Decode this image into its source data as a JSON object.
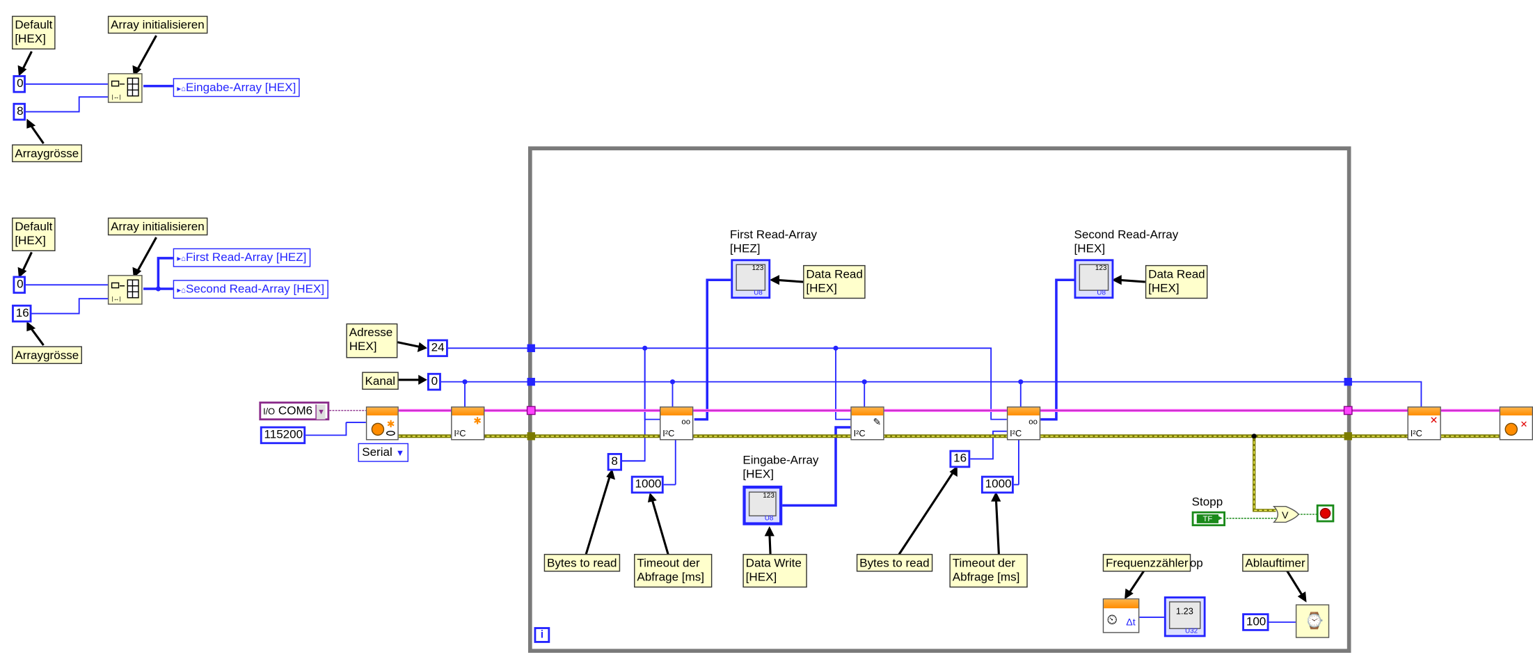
{
  "colors": {
    "wire_blue": "#2424ff",
    "wire_pink": "#ff66ff",
    "wire_error": "#7a7a00",
    "loop_frame": "#7a7a7a",
    "note_bg": "#ffffcc",
    "node_orange": "#ff8c00",
    "bool_green": "#1a8a1a",
    "stop_red": "#e00000"
  },
  "top_block": {
    "default_note": "Default\n[HEX]",
    "array_init_note": "Array initialisieren",
    "const_default": "0",
    "const_size": "8",
    "size_note": "Arraygrösse",
    "indicator": "Eingabe-Array [HEX]"
  },
  "mid_block": {
    "default_note": "Default\n[HEX]",
    "array_init_note": "Array initialisieren",
    "const_default": "0",
    "const_size": "16",
    "size_note": "Arraygrösse",
    "indicator_first": "First Read-Array [HEZ]",
    "indicator_second": "Second Read-Array [HEX]"
  },
  "inputs": {
    "adresse_note": "Adresse\nHEX]",
    "adresse_value": "24",
    "kanal_note": "Kanal",
    "kanal_value": "0",
    "com_port": "COM6",
    "baud": "115200",
    "interface": "Serial"
  },
  "loop": {
    "first_read_label": "First Read-Array\n[HEZ]",
    "first_data_read_note": "Data Read\n[HEX]",
    "second_read_label": "Second Read-Array\n[HEX]",
    "second_data_read_note": "Data Read\n[HEX]",
    "eingabe_label": "Eingabe-Array\n[HEX]",
    "data_write_note": "Data Write\n[HEX]",
    "bytes1_value": "8",
    "timeout1_value": "1000",
    "bytes2_value": "16",
    "timeout2_value": "1000",
    "bytes_note_1": "Bytes to read",
    "timeout_note_1": "Timeout der\nAbfrage [ms]",
    "bytes_note_2": "Bytes to read",
    "timeout_note_2": "Timeout der\nAbfrage [ms]",
    "stopp_label": "Stopp",
    "freq_note": "Frequenzzähler",
    "op_text": "op",
    "ablauf_note": "Ablauftimer",
    "wait_value": "100",
    "iteration_label": "i",
    "node_text": "I²C",
    "tf_text": "TF"
  }
}
